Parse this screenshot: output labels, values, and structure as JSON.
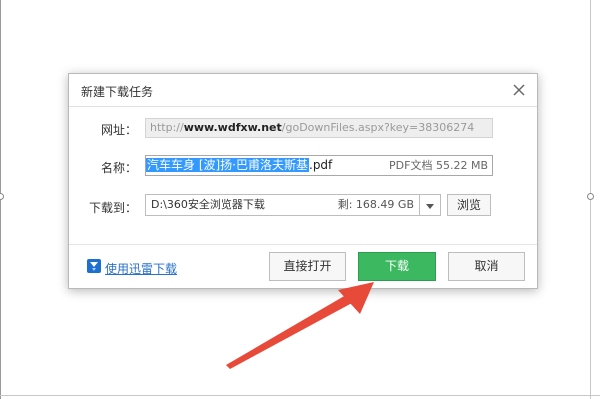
{
  "dialog": {
    "title": "新建下载任务",
    "url_label": "网址：",
    "url_prefix": "http://",
    "url_domain": "www.wdfxw.net",
    "url_path": "/goDownFiles.aspx?key=38306274",
    "name_label": "名称：",
    "filename_selected": "汽车车身 [波]扬·巴甫洛夫斯基",
    "filename_ext": ".pdf",
    "file_meta": "PDF文档 55.22 MB",
    "saveto_label": "下载到：",
    "save_path": "D:\\360安全浏览器下载",
    "free_space": "剩: 168.49 GB",
    "browse_label": "浏览",
    "xunlei_link": "使用迅雷下载",
    "open_label": "直接打开",
    "download_label": "下载",
    "cancel_label": "取消"
  },
  "icons": {
    "close": "close-icon",
    "dropdown": "chevron-down-icon",
    "xunlei": "xunlei-icon",
    "annotation": "red-arrow"
  },
  "colors": {
    "primary_button": "#3cb960",
    "link": "#2a6fc9",
    "selection": "#3399ff",
    "annotation_arrow": "#e84a3a"
  }
}
